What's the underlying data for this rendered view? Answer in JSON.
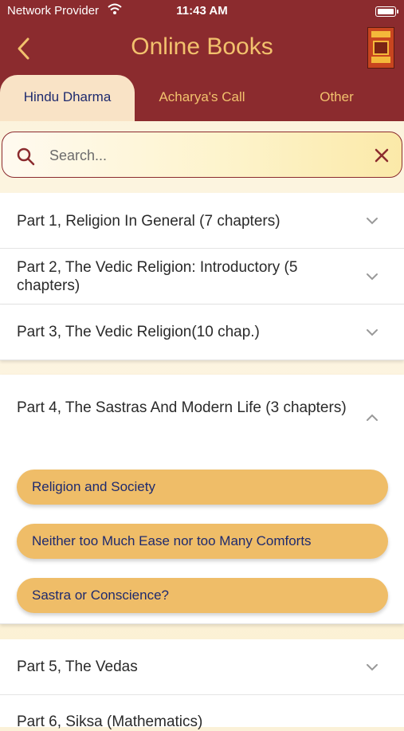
{
  "status_bar": {
    "carrier": "Network Provider",
    "time": "11:43 AM"
  },
  "header": {
    "title": "Online Books"
  },
  "tabs": [
    {
      "label": "Hindu Dharma",
      "active": true
    },
    {
      "label": "Acharya's Call",
      "active": false
    },
    {
      "label": "Other",
      "active": false
    }
  ],
  "search": {
    "placeholder": "Search...",
    "value": ""
  },
  "sections": [
    {
      "label": "Part 1, Religion In General (7 chapters)",
      "expanded": false
    },
    {
      "label": "Part 2, The Vedic Religion: Introductory (5 chapters)",
      "expanded": false
    },
    {
      "label": "Part 3, The Vedic Religion(10 chap.)",
      "expanded": false
    },
    {
      "label": "Part 4, The Sastras And Modern Life (3 chapters)",
      "expanded": true,
      "chapters": [
        "Religion and Society",
        "Neither too Much Ease nor too Many Comforts",
        "Sastra or Conscience?"
      ]
    },
    {
      "label": "Part 5, The Vedas",
      "expanded": false
    },
    {
      "label": "Part 6, Siksa (Mathematics)",
      "expanded": false
    }
  ],
  "colors": {
    "header": "#8b2b2e",
    "accent": "#f2c16d",
    "chapter_button": "#efbd68",
    "tab_active_text": "#1e2a6e"
  },
  "icons": {
    "back": "chevron-left-icon",
    "book": "book-cover-icon",
    "search": "search-icon",
    "clear": "close-icon"
  }
}
